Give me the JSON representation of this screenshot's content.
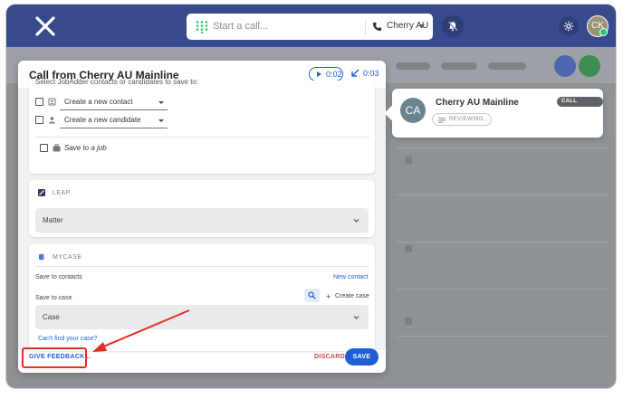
{
  "colors": {
    "accent": "#1f5fd6",
    "topbar": "#364a8c",
    "danger": "#d84040",
    "online": "#28c76f",
    "annotation": "#e42b22"
  },
  "topbar": {
    "logo_icon": "x-logo-icon",
    "call_placeholder": "Start a call...",
    "caller_id": "Cherry AU",
    "user_initials": "CK"
  },
  "modal": {
    "title": "Call from Cherry AU Mainline",
    "playback_time": "0:02",
    "call_duration": "0:03",
    "jobadder": {
      "instruction": "Select JobAdder contacts or candidates to save to:",
      "contact_select": "Create a new contact",
      "candidate_select": "Create a new candidate",
      "save_to_job": "Save to a job"
    },
    "leap": {
      "title": "LEAP",
      "matter_select": "Matter"
    },
    "mycase": {
      "title": "MYCASE",
      "save_to_contacts": "Save to contacts",
      "new_contact": "New contact",
      "save_to_case": "Save to case",
      "create_case": "Create case",
      "case_select": "Case",
      "cant_find": "Can't find your case?"
    },
    "footer": {
      "feedback": "GIVE FEEDBACK...",
      "discard": "DISCARD",
      "save": "SAVE"
    }
  },
  "call_card": {
    "initials": "CA",
    "name": "Cherry AU Mainline",
    "status": "CALL ENDED",
    "reviewing": "REVIEWING..."
  }
}
